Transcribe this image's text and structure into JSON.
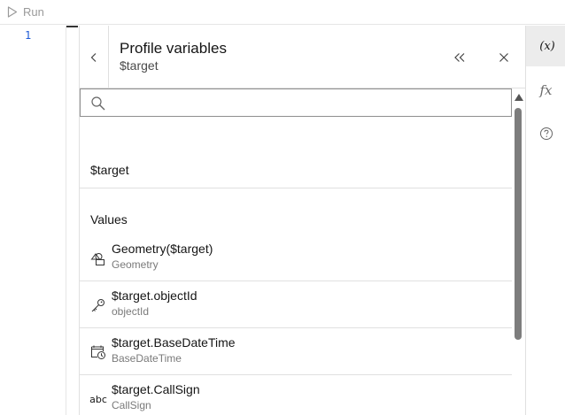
{
  "toolbar": {
    "run_label": "Run"
  },
  "editor": {
    "line_number": "1"
  },
  "panel": {
    "title": "Profile variables",
    "subtitle": "$target",
    "search_placeholder": ""
  },
  "sections": {
    "target_label": "$target",
    "values_label": "Values"
  },
  "items": [
    {
      "name": "Geometry($target)",
      "sub": "Geometry",
      "icon": "geometry-icon"
    },
    {
      "name": "$target.objectId",
      "sub": "objectId",
      "icon": "key-icon"
    },
    {
      "name": "$target.BaseDateTime",
      "sub": "BaseDateTime",
      "icon": "calendar-clock-icon"
    },
    {
      "name": "$target.CallSign",
      "sub": "CallSign",
      "icon": "abc-text-icon",
      "glyph": "abc"
    }
  ],
  "rail": {
    "variables_label": "(x)",
    "functions_label": "fx"
  },
  "colors": {
    "line_number": "#1d5ad6",
    "active_rail": "#ececec",
    "scroll_thumb": "#7d7d7d"
  }
}
